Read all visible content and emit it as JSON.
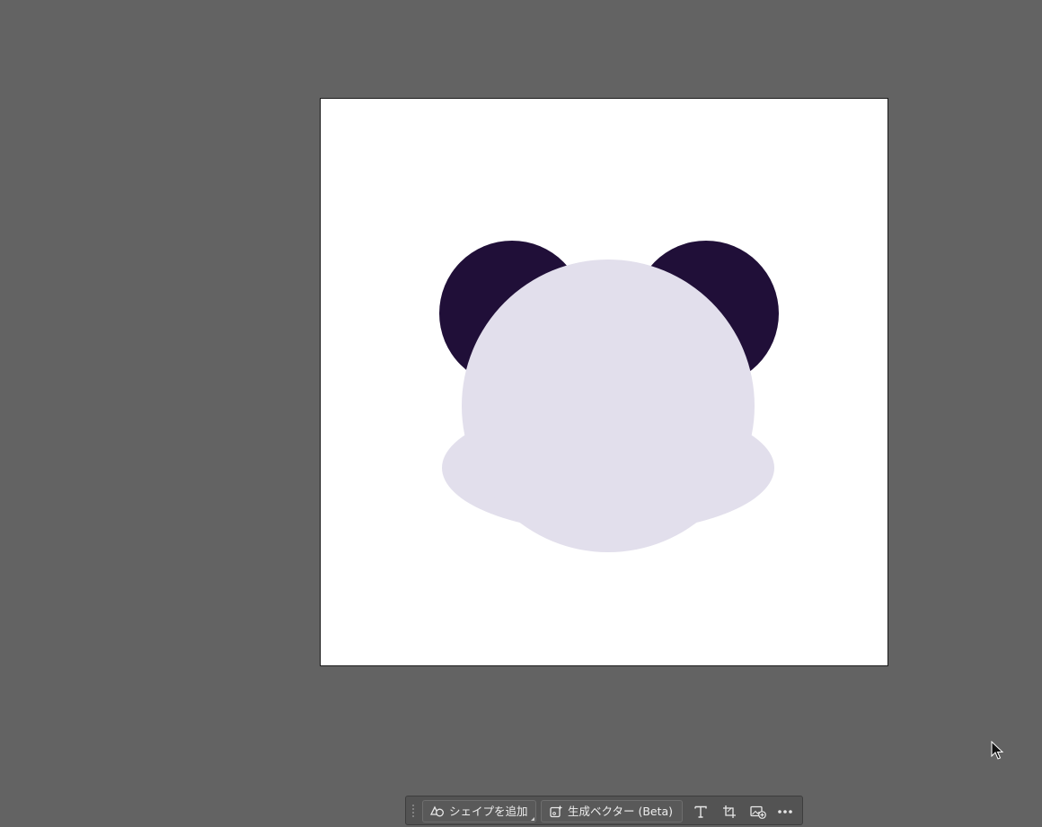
{
  "toolbar": {
    "add_shape_label": "シェイプを追加",
    "generate_vector_label": "生成ベクター (Beta)",
    "icons": [
      "shape-icon",
      "generative-vector-icon",
      "text-icon",
      "crop-icon",
      "place-image-icon",
      "more-icon"
    ]
  },
  "canvas": {
    "artboard_background": "#ffffff",
    "ear_color": "#200f38",
    "face_color": "#e2dfec",
    "workspace_color": "#636363"
  }
}
